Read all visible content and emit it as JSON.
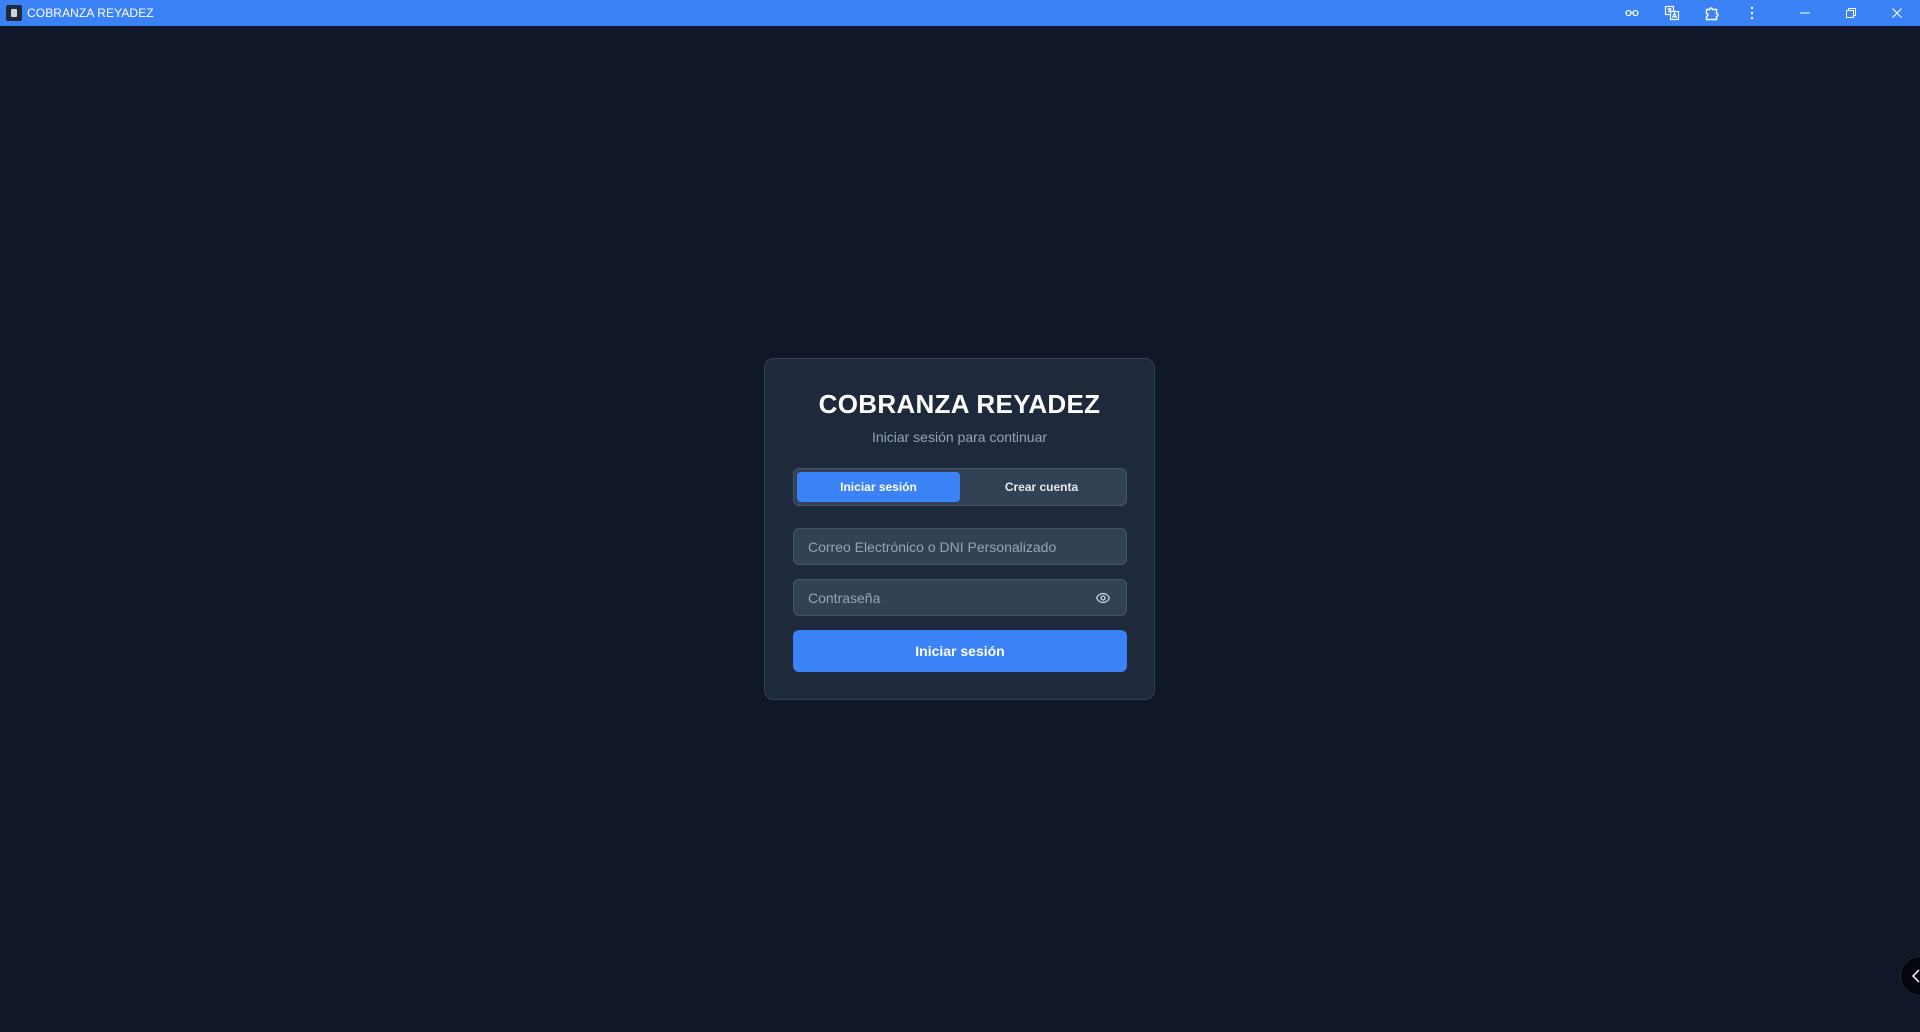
{
  "window": {
    "title": "COBRANZA REYADEZ",
    "accent_color": "#3b82f6",
    "background_color": "#0f1729"
  },
  "toolbar_icons": [
    "key-icon",
    "translate-icon",
    "extensions-icon",
    "more-options-icon"
  ],
  "window_controls": [
    "minimize-icon",
    "restore-icon",
    "close-icon"
  ],
  "login": {
    "title": "COBRANZA REYADEZ",
    "subtitle": "Iniciar sesión para continuar",
    "tabs": [
      {
        "label": "Iniciar sesión",
        "active": true
      },
      {
        "label": "Crear cuenta",
        "active": false
      }
    ],
    "email_placeholder": "Correo Electrónico o DNI Personalizado",
    "email_value": "",
    "password_placeholder": "Contraseña",
    "password_value": "",
    "submit_label": "Iniciar sesión"
  }
}
